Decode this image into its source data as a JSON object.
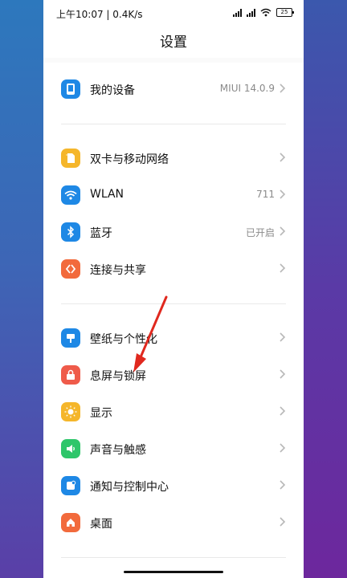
{
  "status_bar": {
    "time_speed": "上午10:07 | 0.4K/s",
    "battery": "25"
  },
  "header": {
    "title": "设置"
  },
  "groups": [
    {
      "items": [
        {
          "label": "我的设备",
          "value": "MIUI 14.0.9",
          "icon": "phone-icon",
          "color": "#1e88e5"
        }
      ]
    },
    {
      "items": [
        {
          "label": "双卡与移动网络",
          "value": "",
          "icon": "sim-card-icon",
          "color": "#f5b62b"
        },
        {
          "label": "WLAN",
          "value": "711",
          "icon": "wifi-icon",
          "color": "#1e88e5"
        },
        {
          "label": "蓝牙",
          "value": "已开启",
          "icon": "bluetooth-icon",
          "color": "#1e88e5"
        },
        {
          "label": "连接与共享",
          "value": "",
          "icon": "connection-share-icon",
          "color": "#f26a3c"
        }
      ]
    },
    {
      "items": [
        {
          "label": "壁纸与个性化",
          "value": "",
          "icon": "wallpaper-icon",
          "color": "#1e88e5"
        },
        {
          "label": "息屏与锁屏",
          "value": "",
          "icon": "lock-icon",
          "color": "#ef5b4a"
        },
        {
          "label": "显示",
          "value": "",
          "icon": "sun-icon",
          "color": "#f5b62b"
        },
        {
          "label": "声音与触感",
          "value": "",
          "icon": "speaker-icon",
          "color": "#2ec66a"
        },
        {
          "label": "通知与控制中心",
          "value": "",
          "icon": "notification-icon",
          "color": "#1e88e5"
        },
        {
          "label": "桌面",
          "value": "",
          "icon": "home-icon",
          "color": "#f26a3c"
        }
      ]
    }
  ],
  "colors": {
    "annotation_arrow": "#e0281e",
    "chevron": "#b8b8b8"
  }
}
